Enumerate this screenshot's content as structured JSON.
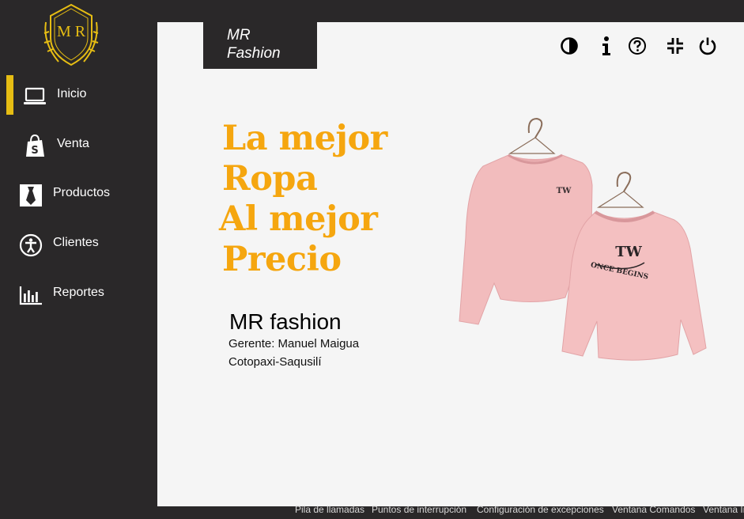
{
  "logo": {
    "initials": "M R"
  },
  "sidebar": {
    "active_color": "#e6bd13",
    "items": [
      {
        "label": "Inicio",
        "icon": "laptop-icon",
        "active": true
      },
      {
        "label": "Venta",
        "icon": "shopping-bag-icon",
        "active": false
      },
      {
        "label": "Productos",
        "icon": "tie-icon",
        "active": false
      },
      {
        "label": "Clientes",
        "icon": "accessibility-icon",
        "active": false
      },
      {
        "label": "Reportes",
        "icon": "bar-chart-icon",
        "active": false
      }
    ]
  },
  "header": {
    "brand_line1": "MR",
    "brand_line2": "Fashion",
    "icons": [
      "contrast-icon",
      "info-icon",
      "help-icon",
      "collapse-icon",
      "power-icon"
    ]
  },
  "hero": {
    "headline": [
      "La mejor",
      "Ropa",
      "Al mejor",
      "Precio"
    ],
    "headline_color": "#f5a60f",
    "business_name": "MR fashion",
    "manager": "Gerente: Manuel Maigua",
    "location": "Cotopaxi-Saqusilí",
    "product_print_logo": "TW",
    "product_print_text": "ONCE BEGINS"
  },
  "statusbar": {
    "items": [
      "Pila de llamadas",
      "Puntos de interrupción",
      "Configuración de excepciones",
      "Ventana Comandos",
      "Ventana In"
    ]
  }
}
